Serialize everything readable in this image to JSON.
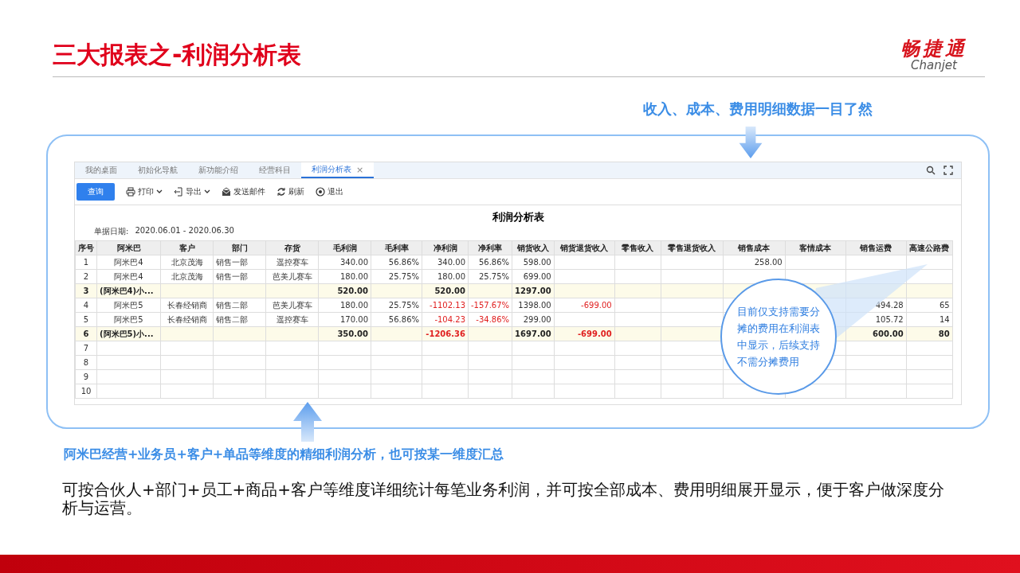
{
  "slide": {
    "title": "三大报表之-利润分析表",
    "logo": {
      "mark": "畅捷通",
      "name": "Chanjet"
    },
    "top_note": "收入、成本、费用明细数据一目了然",
    "bottom_note": "阿米巴经营+业务员+客户+单品等维度的精细利润分析，也可按某一维度汇总",
    "description": "可按合伙人+部门+员工+商品+客户等维度详细统计每笔业务利润，并可按全部成本、费用明细展开显示，便于客户做深度分析与运营。"
  },
  "app": {
    "tabs": [
      {
        "label": "我的桌面",
        "selected": false
      },
      {
        "label": "初始化导航",
        "selected": false
      },
      {
        "label": "新功能介绍",
        "selected": false
      },
      {
        "label": "经营科目",
        "selected": false
      },
      {
        "label": "利润分析表",
        "selected": true,
        "close": "×"
      }
    ],
    "toolbar": [
      {
        "kind": "primary",
        "label": "查询"
      },
      {
        "kind": "print",
        "label": "打印",
        "dropdown": true
      },
      {
        "kind": "export",
        "label": "导出",
        "dropdown": true
      },
      {
        "kind": "mail",
        "label": "发送邮件",
        "dropdown": false
      },
      {
        "kind": "refresh",
        "label": "刷新",
        "dropdown": false
      },
      {
        "kind": "exit",
        "label": "退出",
        "dropdown": false
      }
    ],
    "report_title": "利润分析表",
    "date_label": "单据日期:",
    "date_range": "2020.06.01 - 2020.06.30",
    "table": {
      "columns": [
        "序号",
        "阿米巴",
        "客户",
        "部门",
        "存货",
        "毛利润",
        "毛利率",
        "净利润",
        "净利率",
        "销货收入",
        "销货退货收入",
        "零售收入",
        "零售退货收入",
        "销售成本",
        "客情成本",
        "销售运费",
        "高速公路费"
      ],
      "rows": [
        {
          "subtotal": false,
          "cells": [
            "1",
            "阿米巴4",
            "北京茂海",
            "销售一部",
            "遥控赛车",
            "340.00",
            "56.86%",
            "340.00",
            "56.86%",
            "598.00",
            "",
            "",
            "",
            "258.00",
            "",
            "",
            ""
          ]
        },
        {
          "subtotal": false,
          "cells": [
            "2",
            "阿米巴4",
            "北京茂海",
            "销售一部",
            "芭美儿赛车",
            "180.00",
            "25.75%",
            "180.00",
            "25.75%",
            "699.00",
            "",
            "",
            "",
            "",
            "",
            "",
            ""
          ]
        },
        {
          "subtotal": true,
          "cells": [
            "3",
            "(阿米巴4)小...",
            "",
            "",
            "",
            "520.00",
            "",
            "520.00",
            "",
            "1297.00",
            "",
            "",
            "",
            "",
            "",
            "",
            ""
          ]
        },
        {
          "subtotal": false,
          "cells": [
            "4",
            "阿米巴5",
            "长春经销商",
            "销售二部",
            "芭美儿赛车",
            "180.00",
            "25.75%",
            {
              "text": "-1102.13",
              "negative": true
            },
            {
              "text": "-157.67%",
              "negative": true
            },
            "1398.00",
            {
              "text": "-699.00",
              "negative": true
            },
            "",
            "",
            "",
            "",
            "494.28",
            "65"
          ]
        },
        {
          "subtotal": false,
          "cells": [
            "5",
            "阿米巴5",
            "长春经销商",
            "销售二部",
            "遥控赛车",
            "170.00",
            "56.86%",
            {
              "text": "-104.23",
              "negative": true
            },
            {
              "text": "-34.86%",
              "negative": true
            },
            "299.00",
            "",
            "",
            "",
            "",
            "",
            "105.72",
            "14"
          ]
        },
        {
          "subtotal": true,
          "cells": [
            "6",
            "(阿米巴5)小...",
            "",
            "",
            "",
            "350.00",
            "",
            {
              "text": "-1206.36",
              "negative": true
            },
            "",
            "1697.00",
            {
              "text": "-699.00",
              "negative": true
            },
            "",
            "",
            "",
            "",
            "600.00",
            "80"
          ]
        },
        {
          "subtotal": false,
          "cells": [
            "7",
            "",
            "",
            "",
            "",
            "",
            "",
            "",
            "",
            "",
            "",
            "",
            "",
            "",
            "",
            "",
            ""
          ]
        },
        {
          "subtotal": false,
          "cells": [
            "8",
            "",
            "",
            "",
            "",
            "",
            "",
            "",
            "",
            "",
            "",
            "",
            "",
            "",
            "",
            "",
            ""
          ]
        },
        {
          "subtotal": false,
          "cells": [
            "9",
            "",
            "",
            "",
            "",
            "",
            "",
            "",
            "",
            "",
            "",
            "",
            "",
            "",
            "",
            "",
            ""
          ]
        },
        {
          "subtotal": false,
          "cells": [
            "10",
            "",
            "",
            "",
            "",
            "",
            "",
            "",
            "",
            "",
            "",
            "",
            "",
            "",
            "",
            "",
            ""
          ]
        }
      ]
    },
    "callout": "目前仅支持需要分摊的费用在利润表中显示，后续支持不需分摊费用"
  }
}
